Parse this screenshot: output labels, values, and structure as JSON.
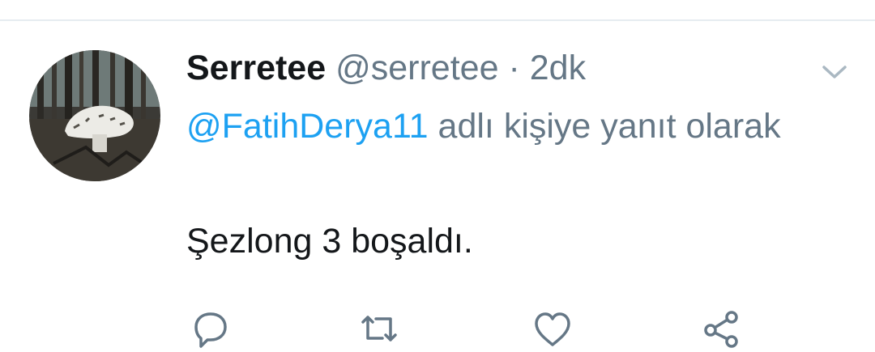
{
  "tweet": {
    "display_name": "Serretee",
    "handle": "@serretee",
    "separator": "·",
    "time": "2dk",
    "reply_mention": "@FatihDerya11",
    "reply_suffix": "adlı kişiye yanıt olarak",
    "text": "Şezlong 3 boşaldı."
  },
  "actions": {
    "reply_icon": "reply-bubble-icon",
    "retweet_icon": "retweet-icon",
    "like_icon": "heart-icon",
    "share_icon": "share-icon"
  },
  "colors": {
    "accent": "#1da1f2",
    "secondary_text": "#657786",
    "primary_text": "#14171a",
    "divider": "#e6ecf0"
  }
}
